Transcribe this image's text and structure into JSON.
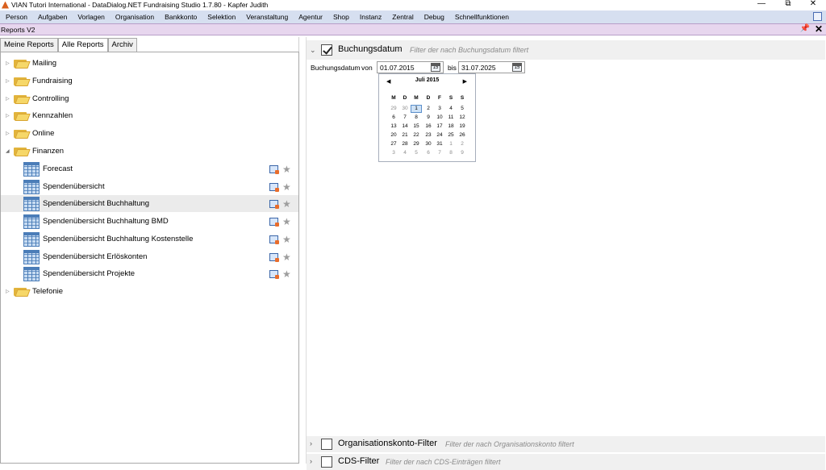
{
  "window": {
    "title": "VIAN Tutori International - DataDialog.NET Fundraising Studio 1.7.80 - Kapfer Judith",
    "minimize": "—",
    "maximize": "⧉",
    "close": "✕"
  },
  "menu": {
    "items": [
      "Person",
      "Aufgaben",
      "Vorlagen",
      "Organisation",
      "Bankkonto",
      "Selektion",
      "Veranstaltung",
      "Agentur",
      "Shop",
      "Instanz",
      "Zentral",
      "Debug",
      "Schnellfunktionen"
    ]
  },
  "doc": {
    "title": "Reports V2",
    "pin": "📌",
    "close": "✕"
  },
  "tabs": [
    "Meine Reports",
    "Alle Reports",
    "Archiv"
  ],
  "tree": {
    "folders": [
      {
        "label": "Mailing",
        "expander": "▷"
      },
      {
        "label": "Fundraising",
        "expander": "▷"
      },
      {
        "label": "Controlling",
        "expander": "▷"
      },
      {
        "label": "Kennzahlen",
        "expander": "▷"
      },
      {
        "label": "Online",
        "expander": "▷"
      },
      {
        "label": "Finanzen",
        "expander": "◢"
      },
      {
        "label": "Telefonie",
        "expander": "▷"
      }
    ],
    "reports": [
      {
        "label": "Forecast"
      },
      {
        "label": "Spendenübersicht"
      },
      {
        "label": "Spendenübersicht Buchhaltung"
      },
      {
        "label": "Spendenübersicht Buchhaltung BMD"
      },
      {
        "label": "Spendenübersicht Buchhaltung Kostenstelle"
      },
      {
        "label": "Spendenübersicht Erlöskonten"
      },
      {
        "label": "Spendenübersicht Projekte"
      }
    ],
    "star": "★"
  },
  "filters": {
    "buchungsdatum": {
      "chevron": "⌄",
      "title": "Buchungsdatum",
      "description": "Filter der nach Buchungsdatum filtert",
      "label": "Buchungsdatum",
      "from_label": "von",
      "from_value": "01.07.2015",
      "to_label": "bis",
      "to_value": "31.07.2025",
      "cal_icon_text": "15"
    },
    "organisationskonto": {
      "chevron": "›",
      "title": "Organisationskonto-Filter",
      "description": "Filter der nach Organisationskonto filtert"
    },
    "cds": {
      "chevron": "›",
      "title": "CDS-Filter",
      "description": "Filter der nach CDS-Einträgen filtert"
    }
  },
  "calendar": {
    "month": "Juli 2015",
    "prev": "◀",
    "next": "▶",
    "weekdays": [
      "M",
      "D",
      "M",
      "D",
      "F",
      "S",
      "S"
    ],
    "weeks": [
      [
        "29",
        "30",
        "1",
        "2",
        "3",
        "4",
        "5"
      ],
      [
        "6",
        "7",
        "8",
        "9",
        "10",
        "11",
        "12"
      ],
      [
        "13",
        "14",
        "15",
        "16",
        "17",
        "18",
        "19"
      ],
      [
        "20",
        "21",
        "22",
        "23",
        "24",
        "25",
        "26"
      ],
      [
        "27",
        "28",
        "29",
        "30",
        "31",
        "1",
        "2"
      ],
      [
        "3",
        "4",
        "5",
        "6",
        "7",
        "8",
        "9"
      ]
    ],
    "selected": "1"
  }
}
